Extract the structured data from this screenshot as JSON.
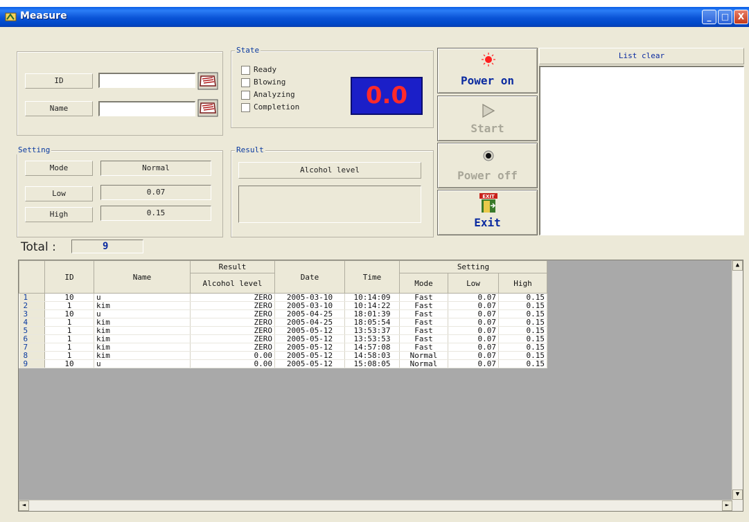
{
  "window": {
    "title": "Measure",
    "minimize": "_",
    "maximize": "□",
    "close": "X"
  },
  "identity": {
    "id_label": "ID",
    "id_value": "",
    "name_label": "Name",
    "name_value": ""
  },
  "state": {
    "title": "State",
    "items": [
      "Ready",
      "Blowing",
      "Analyzing",
      "Completion"
    ],
    "display_value": "0.0"
  },
  "setting": {
    "title": "Setting",
    "mode_label": "Mode",
    "mode_value": "Normal",
    "low_label": "Low",
    "low_value": "0.07",
    "high_label": "High",
    "high_value": "0.15"
  },
  "result": {
    "title": "Result",
    "header": "Alcohol level",
    "value": ""
  },
  "buttons": {
    "power_on": "Power on",
    "start": "Start",
    "power_off": "Power off",
    "exit": "Exit",
    "exit_sign": "EXIT"
  },
  "list": {
    "clear_label": "List clear",
    "items": []
  },
  "total": {
    "label": "Total :",
    "value": "9"
  },
  "table": {
    "headers": {
      "id": "ID",
      "name": "Name",
      "result": "Result",
      "alcohol": "Alcohol level",
      "date": "Date",
      "time": "Time",
      "setting": "Setting",
      "mode": "Mode",
      "low": "Low",
      "high": "High"
    },
    "rows": [
      {
        "n": "1",
        "id": "10",
        "name": "u",
        "result": "ZERO",
        "date": "2005-03-10",
        "time": "10:14:09",
        "mode": "Fast",
        "low": "0.07",
        "high": "0.15"
      },
      {
        "n": "2",
        "id": "1",
        "name": "kim",
        "result": "ZERO",
        "date": "2005-03-10",
        "time": "10:14:22",
        "mode": "Fast",
        "low": "0.07",
        "high": "0.15"
      },
      {
        "n": "3",
        "id": "10",
        "name": "u",
        "result": "ZERO",
        "date": "2005-04-25",
        "time": "18:01:39",
        "mode": "Fast",
        "low": "0.07",
        "high": "0.15"
      },
      {
        "n": "4",
        "id": "1",
        "name": "kim",
        "result": "ZERO",
        "date": "2005-04-25",
        "time": "18:05:54",
        "mode": "Fast",
        "low": "0.07",
        "high": "0.15"
      },
      {
        "n": "5",
        "id": "1",
        "name": "kim",
        "result": "ZERO",
        "date": "2005-05-12",
        "time": "13:53:37",
        "mode": "Fast",
        "low": "0.07",
        "high": "0.15"
      },
      {
        "n": "6",
        "id": "1",
        "name": "kim",
        "result": "ZERO",
        "date": "2005-05-12",
        "time": "13:53:53",
        "mode": "Fast",
        "low": "0.07",
        "high": "0.15"
      },
      {
        "n": "7",
        "id": "1",
        "name": "kim",
        "result": "ZERO",
        "date": "2005-05-12",
        "time": "14:57:08",
        "mode": "Fast",
        "low": "0.07",
        "high": "0.15"
      },
      {
        "n": "8",
        "id": "1",
        "name": "kim",
        "result": "0.00",
        "date": "2005-05-12",
        "time": "14:58:03",
        "mode": "Normal",
        "low": "0.07",
        "high": "0.15"
      },
      {
        "n": "9",
        "id": "10",
        "name": "u",
        "result": "0.00",
        "date": "2005-05-12",
        "time": "15:08:05",
        "mode": "Normal",
        "low": "0.07",
        "high": "0.15"
      }
    ]
  },
  "colors": {
    "titlebar": "#0a53d6",
    "window_bg": "#ece9d8",
    "display_bg": "#1b1fc8",
    "display_fg": "#ff2a2a",
    "power_on_text": "#0a2aa0",
    "disabled_text": "#a8a698"
  }
}
